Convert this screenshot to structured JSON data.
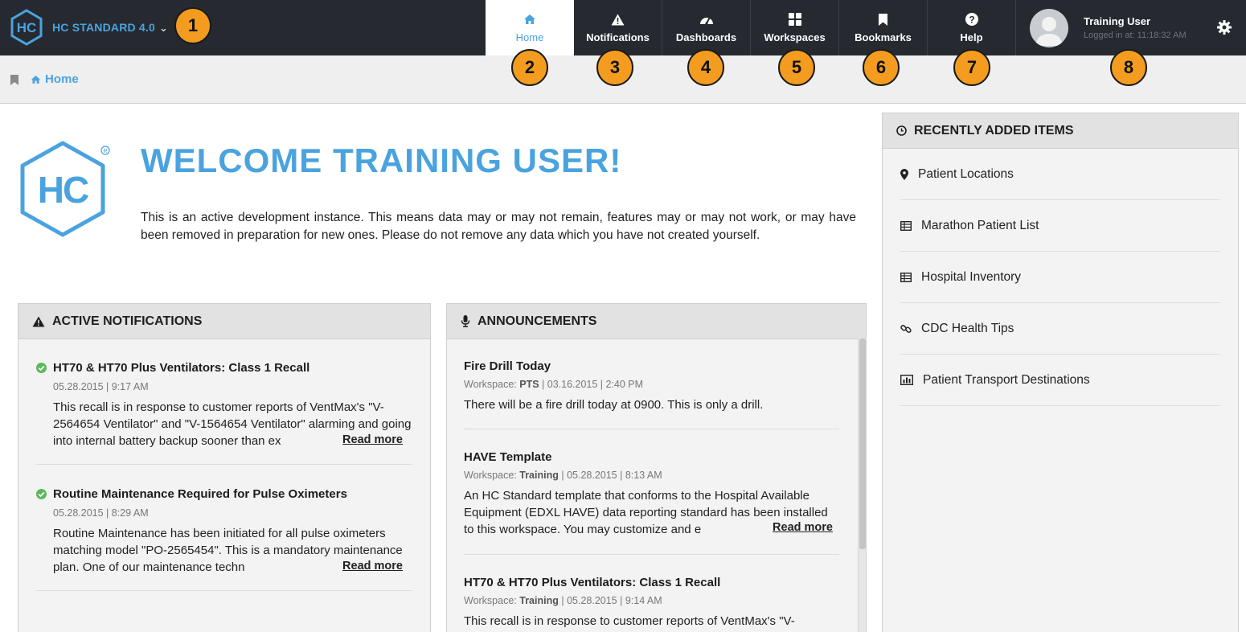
{
  "app": {
    "brand_name": "HC STANDARD 4.0",
    "logo_letters": "HC"
  },
  "nav": {
    "items": [
      {
        "label": "Home",
        "icon": "home-icon",
        "active": true
      },
      {
        "label": "Notifications",
        "icon": "warning-icon",
        "active": false
      },
      {
        "label": "Dashboards",
        "icon": "dashboard-icon",
        "active": false
      },
      {
        "label": "Workspaces",
        "icon": "grid-icon",
        "active": false
      },
      {
        "label": "Bookmarks",
        "icon": "bookmark-icon",
        "active": false
      },
      {
        "label": "Help",
        "icon": "help-icon",
        "active": false
      }
    ]
  },
  "user": {
    "name": "Training User",
    "login_info": "Logged in at: 11:18:32 AM"
  },
  "badges": [
    "1",
    "2",
    "3",
    "4",
    "5",
    "6",
    "7",
    "8"
  ],
  "breadcrumb": {
    "label": "Home"
  },
  "welcome": {
    "title": "WELCOME TRAINING USER!",
    "text": "This is an active development instance. This means data may or may not remain, features may or may not work, or may have been removed in preparation for new ones. Please do not remove any data which you have not created yourself."
  },
  "notifications": {
    "title": "ACTIVE NOTIFICATIONS",
    "items": [
      {
        "title": "HT70 & HT70 Plus Ventilators: Class 1 Recall",
        "date": "05.28.2015 | 9:17 AM",
        "body": "This recall is in response to customer reports of VentMax's \"V-2564654 Ventilator\" and \"V-1564654 Ventilator\" alarming and going into internal battery backup sooner than ex",
        "read_more": "Read more"
      },
      {
        "title": "Routine Maintenance Required for Pulse Oximeters",
        "date": "05.28.2015 | 8:29 AM",
        "body": "Routine Maintenance has been initiated for all pulse oximeters matching model \"PO-2565454\". This is a mandatory maintenance plan. One of our maintenance techn",
        "read_more": "Read more"
      }
    ]
  },
  "announcements": {
    "title": "ANNOUNCEMENTS",
    "items": [
      {
        "title": "Fire Drill Today",
        "ws_prefix": "Workspace: ",
        "workspace": "PTS",
        "meta": " | 03.16.2015 | 2:40 PM",
        "body": "There will be a fire drill today at 0900. This is only a drill."
      },
      {
        "title": "HAVE Template",
        "ws_prefix": "Workspace: ",
        "workspace": "Training",
        "meta": " | 05.28.2015 | 8:13 AM",
        "body": "An HC Standard template that conforms to the Hospital Available Equipment (EDXL HAVE) data reporting standard has been installed to this workspace. You may customize and e",
        "read_more": "Read more"
      },
      {
        "title": "HT70 & HT70 Plus Ventilators: Class 1 Recall",
        "ws_prefix": "Workspace: ",
        "workspace": "Training",
        "meta": " | 05.28.2015 | 9:14 AM",
        "body": "This recall is in response to customer reports of VentMax's \"V-"
      }
    ]
  },
  "recent": {
    "title": "RECENTLY ADDED ITEMS",
    "items": [
      {
        "label": "Patient Locations",
        "icon": "map-marker-icon"
      },
      {
        "label": "Marathon Patient List",
        "icon": "table-icon"
      },
      {
        "label": "Hospital Inventory",
        "icon": "table-icon"
      },
      {
        "label": "CDC Health Tips",
        "icon": "link-icon"
      },
      {
        "label": "Patient Transport Destinations",
        "icon": "bar-chart-icon"
      }
    ]
  },
  "colors": {
    "accent": "#4aa3df",
    "topbar": "#262a30",
    "badge": "#f39c1f",
    "check": "#5cb85c"
  }
}
